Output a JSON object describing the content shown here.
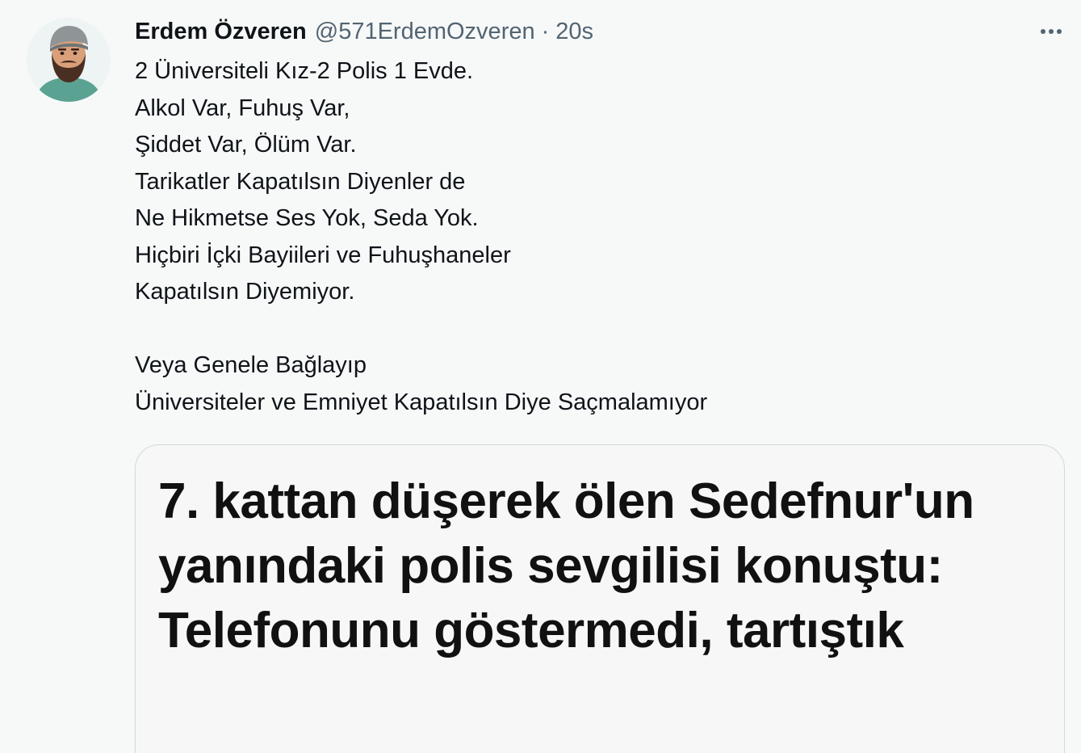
{
  "tweet": {
    "author": {
      "display_name": "Erdem Özveren",
      "handle": "@571ErdemOzveren",
      "separator": "·",
      "time": "20s"
    },
    "more_icon": "more-horizontal-icon",
    "text": "2 Üniversiteli Kız-2 Polis 1 Evde.\nAlkol Var, Fuhuş Var,\nŞiddet Var, Ölüm Var.\nTarikatler Kapatılsın Diyenler de\nNe Hikmetse Ses Yok, Seda Yok.\nHiçbiri İçki Bayiileri ve Fuhuşhaneler\nKapatılsın Diyemiyor.\n\nVeya Genele Bağlayıp\nÜniversiteler ve Emniyet Kapatılsın Diye Saçmalamıyor",
    "card": {
      "headline": "7. kattan düşerek ölen Sedefnur'un yanındaki polis sevgilisi konuştu: Telefonunu göstermedi, tartıştık"
    }
  },
  "colors": {
    "background": "#f7f9f9",
    "text_primary": "#0f1419",
    "text_secondary": "#536471",
    "card_border": "#cfd9de"
  }
}
